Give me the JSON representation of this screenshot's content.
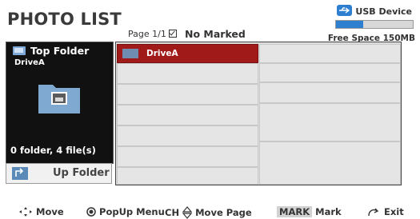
{
  "header": {
    "title": "PHOTO LIST",
    "page_label": "Page 1/1",
    "marked_label": "No Marked"
  },
  "usb": {
    "label": "USB Device",
    "free_space": "Free Space 150MB",
    "usage_fraction": 0.35,
    "accent": "#2f7fd0"
  },
  "left_panel": {
    "folder_label": "Top Folder",
    "drive": "DriveA",
    "count": "0 folder, 4 file(s)",
    "up_folder": "Up Folder"
  },
  "grid": {
    "selected_color": "#a11a1a",
    "items": [
      {
        "label": "DriveA",
        "selected": true
      },
      {
        "label": ""
      },
      {
        "label": ""
      },
      {
        "label": ""
      },
      {
        "label": ""
      },
      {
        "label": ""
      },
      {
        "label": ""
      },
      {
        "label": ""
      }
    ]
  },
  "footer": {
    "move": "Move",
    "popup": "PopUp Menu",
    "ch": "CH",
    "move_page": "Move Page",
    "mark_key": "MARK",
    "mark": "Mark",
    "exit": "Exit"
  }
}
